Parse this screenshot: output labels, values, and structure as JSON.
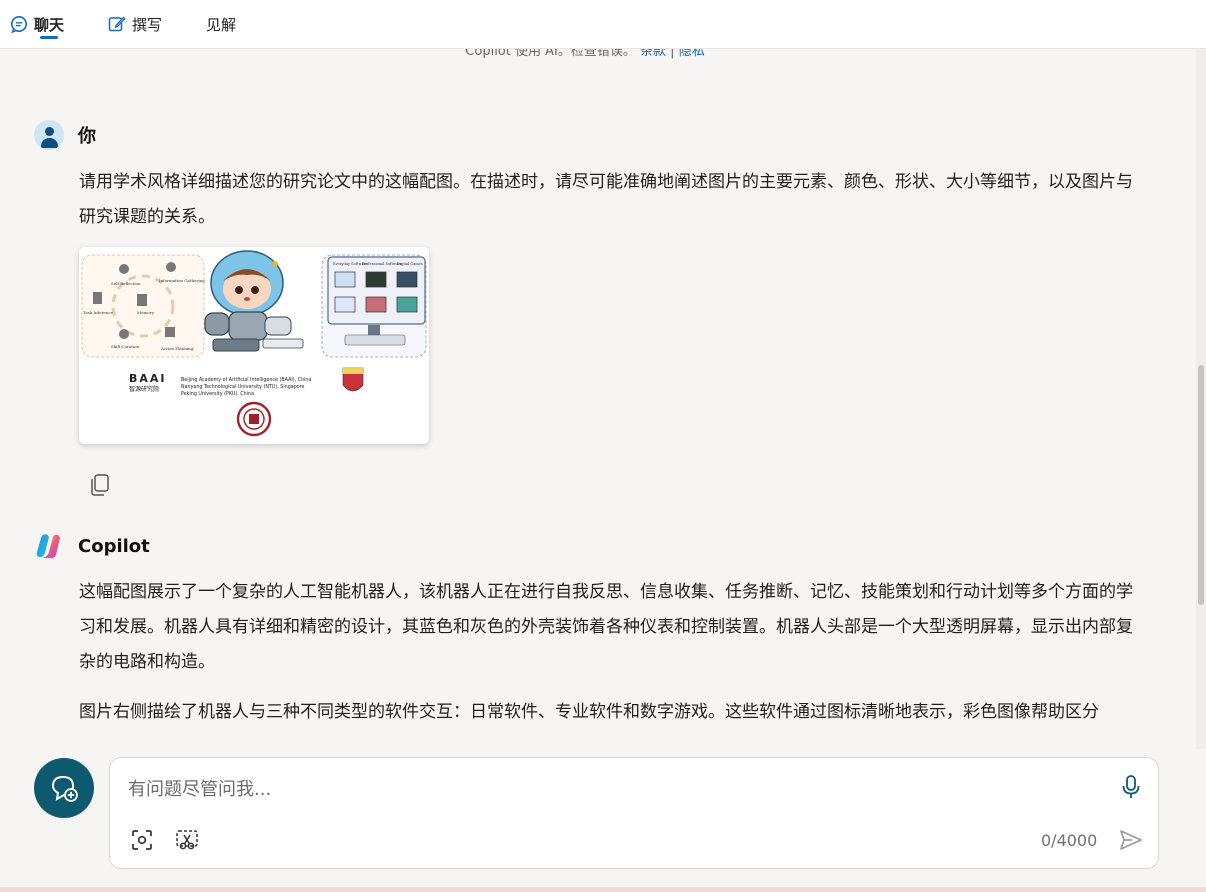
{
  "tabs": [
    {
      "label": "聊天",
      "icon": "chat-icon",
      "active": true
    },
    {
      "label": "撰写",
      "icon": "compose-icon",
      "active": false
    },
    {
      "label": "见解",
      "icon": "",
      "active": false
    }
  ],
  "disclaimer": {
    "text": "Copilot 使用 AI。检查错误。",
    "terms_link": "条款",
    "separator": "|",
    "privacy_link": "隐私"
  },
  "user_message": {
    "speaker": "你",
    "text": "请用学术风格详细描述您的研究论文中的这幅配图。在描述时，请尽可能准确地阐述图片的主要元素、颜色、形状、大小等细节，以及图片与研究课题的关系。",
    "image": {
      "cycle_labels": [
        "Self-Reflection",
        "Information Gathering",
        "Task Inference",
        "Memory",
        "Skill Curation",
        "Action Planning"
      ],
      "software_labels": [
        "Everyday Software",
        "Professional Software",
        "Digital Games"
      ],
      "institutions": [
        "Beijing Academy of Artificial Intelligence (BAAI), China",
        "Nanyang Technological University (NTU), Singapore",
        "Peking University (PKU), China"
      ],
      "logo_text": "BAAI",
      "logo_subtext": "智源研究院"
    }
  },
  "assistant_message": {
    "speaker": "Copilot",
    "paragraphs": [
      "这幅配图展示了一个复杂的人工智能机器人，该机器人正在进行自我反思、信息收集、任务推断、记忆、技能策划和行动计划等多个方面的学习和发展。机器人具有详细和精密的设计，其蓝色和灰色的外壳装饰着各种仪表和控制装置。机器人头部是一个大型透明屏幕，显示出内部复杂的电路和构造。",
      "图片右侧描绘了机器人与三种不同类型的软件交互：日常软件、专业软件和数字游戏。这些软件通过图标清晰地表示，彩色图像帮助区分"
    ]
  },
  "input": {
    "placeholder": "有问题尽管问我...",
    "counter": "0/4000"
  },
  "colors": {
    "accent": "#0f6cbd",
    "new_topic_button": "#0d5a6e"
  }
}
